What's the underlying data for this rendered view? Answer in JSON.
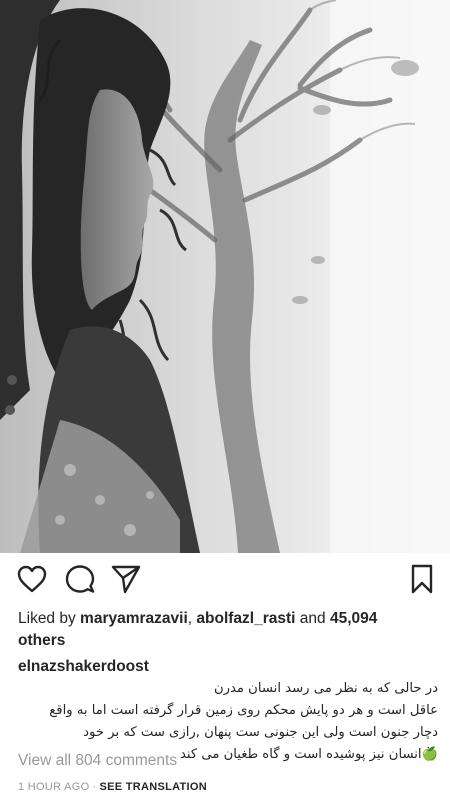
{
  "post": {
    "image_alt": "black and white photo of a woman with curly hair in profile beside a painted tree",
    "actions": {
      "like_icon": "heart-outline-icon",
      "comment_icon": "comment-bubble-icon",
      "share_icon": "paper-plane-icon",
      "save_icon": "bookmark-icon"
    },
    "likes": {
      "prefix": "Liked by",
      "user1": "maryamrazavii",
      "separator": ",",
      "user2": "abolfazl_rasti",
      "conjunction": "and",
      "count": "45,094",
      "suffix": "others"
    },
    "caption": {
      "username": "elnazshakerdoost",
      "text": "در حالی که به نظر می رسد انسان مدرن\nعاقل است و هر دو پایش محکم روی زمین قرار گرفته است اما به واقع\nدچار جنون است ولی این جنونی ست پنهان ,رازی ست که بر خود\n🍏انسان نیز پوشیده است و گاه طغیان می کند"
    },
    "comments_link": "View all 804 comments",
    "timestamp": "1 HOUR AGO",
    "separator_dot": "·",
    "see_translation": "SEE TRANSLATION"
  }
}
